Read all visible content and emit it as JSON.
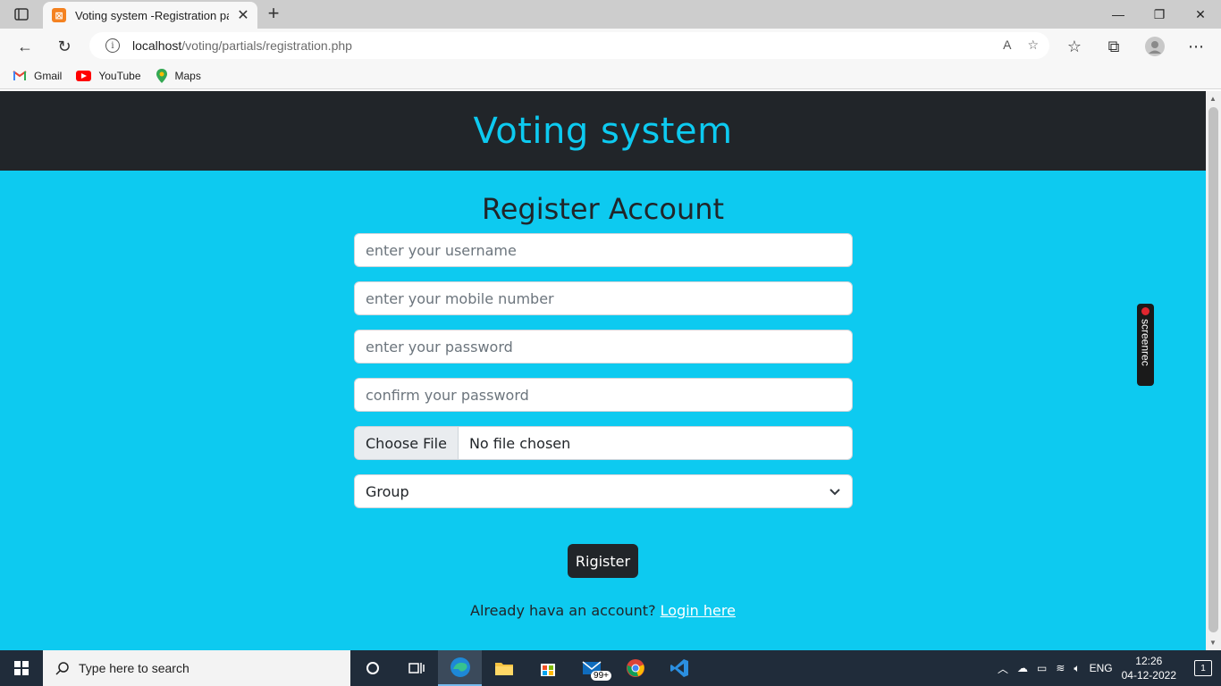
{
  "browser": {
    "tab_title": "Voting system -Registration page",
    "url_host": "localhost",
    "url_path": "/voting/partials/registration.php",
    "bookmarks": [
      {
        "label": "Gmail",
        "icon": "gmail-icon"
      },
      {
        "label": "YouTube",
        "icon": "youtube-icon"
      },
      {
        "label": "Maps",
        "icon": "maps-icon"
      }
    ]
  },
  "page": {
    "site_title": "Voting system",
    "form_title": "Register Account",
    "fields": {
      "username_placeholder": "enter your username",
      "mobile_placeholder": "enter your mobile number",
      "password_placeholder": "enter your password",
      "confirm_placeholder": "confirm your password"
    },
    "file_input": {
      "button_label": "Choose File",
      "status": "No file chosen"
    },
    "group_select": {
      "selected": "Group"
    },
    "register_label": "Rigister",
    "login_prompt": "Already hava an account?",
    "login_link": "Login here",
    "screenrec_label": "screenrec"
  },
  "taskbar": {
    "search_placeholder": "Type here to search",
    "mail_badge": "99+",
    "language": "ENG",
    "time": "12:26",
    "date": "04-12-2022",
    "notification_count": "1"
  },
  "colors": {
    "header_bg": "#212529",
    "page_bg": "#0dcaf0",
    "title_color": "#0dcaf0"
  }
}
